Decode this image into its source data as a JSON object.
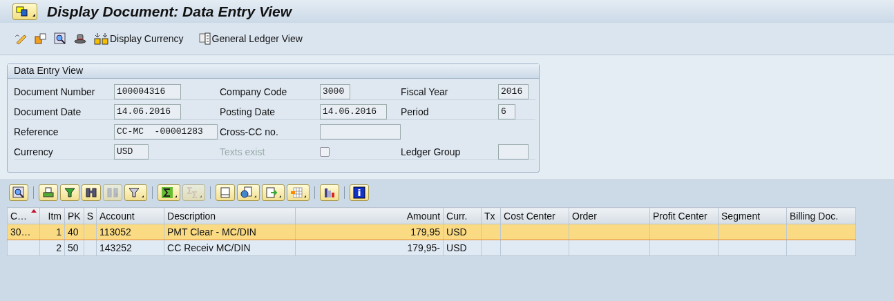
{
  "window": {
    "title": "Display Document: Data Entry View"
  },
  "app_toolbar": [
    {
      "kind": "pencil"
    },
    {
      "kind": "switch"
    },
    {
      "kind": "zoom"
    },
    {
      "kind": "hat"
    },
    {
      "kind": "currency",
      "label": "Display Currency"
    },
    {
      "kind": "ledger",
      "label": "General Ledger View"
    }
  ],
  "header": {
    "title": "Data Entry View",
    "rows": [
      [
        {
          "label": "Document Number",
          "value": "100004316",
          "kind": "field",
          "disabled": false
        },
        {
          "label": "Company Code",
          "value": "3000",
          "kind": "field",
          "disabled": false
        },
        {
          "label": "Fiscal Year",
          "value": "2016",
          "kind": "field",
          "disabled": false
        }
      ],
      [
        {
          "label": "Document Date",
          "value": "14.06.2016",
          "kind": "field",
          "disabled": false
        },
        {
          "label": "Posting Date",
          "value": "14.06.2016",
          "kind": "field",
          "disabled": false
        },
        {
          "label": "Period",
          "value": "6",
          "kind": "field",
          "disabled": false
        }
      ],
      [
        {
          "label": "Reference",
          "value": "CC-MC  -00001283",
          "kind": "field",
          "disabled": false
        },
        {
          "label": "Cross-CC no.",
          "kind": "field",
          "disabled": false
        }
      ],
      [
        {
          "label": "Currency",
          "value": "USD",
          "kind": "field",
          "disabled": false
        },
        {
          "label": "Texts exist",
          "kind": "checkbox",
          "checked": false,
          "disabled": true
        },
        {
          "label": "Ledger Group",
          "kind": "field",
          "disabled": false
        }
      ]
    ]
  },
  "grid_toolbar": [
    [
      {
        "kind": "zoom",
        "dropdown": false,
        "disabled": false
      }
    ],
    [
      {
        "kind": "print",
        "dropdown": false,
        "disabled": false
      },
      {
        "kind": "funnel",
        "dropdown": false,
        "disabled": false
      },
      {
        "kind": "find",
        "dropdown": false,
        "disabled": false
      },
      {
        "kind": "find-next",
        "dropdown": false,
        "disabled": true
      },
      {
        "kind": "filter",
        "dropdown": true,
        "disabled": false
      }
    ],
    [
      {
        "kind": "sum",
        "dropdown": true,
        "disabled": false
      },
      {
        "kind": "subtotal",
        "dropdown": true,
        "disabled": true
      }
    ],
    [
      {
        "kind": "document",
        "dropdown": false,
        "disabled": false
      },
      {
        "kind": "views",
        "dropdown": true,
        "disabled": false
      },
      {
        "kind": "export",
        "dropdown": true,
        "disabled": false
      },
      {
        "kind": "layout",
        "dropdown": true,
        "disabled": false
      }
    ],
    [
      {
        "kind": "chart",
        "dropdown": false,
        "disabled": false
      }
    ],
    [
      {
        "kind": "info",
        "dropdown": false,
        "disabled": false
      }
    ]
  ],
  "table": {
    "columns": [
      {
        "label": "C…",
        "sorted": true
      },
      {
        "label": "Itm",
        "sorted": false
      },
      {
        "label": "PK",
        "sorted": false
      },
      {
        "label": "S",
        "sorted": false
      },
      {
        "label": "Account",
        "sorted": false
      },
      {
        "label": "Description",
        "sorted": false
      },
      {
        "label": "Amount",
        "sorted": false
      },
      {
        "label": "Curr.",
        "sorted": false
      },
      {
        "label": "Tx",
        "sorted": false
      },
      {
        "label": "Cost Center",
        "sorted": false
      },
      {
        "label": "Order",
        "sorted": false
      },
      {
        "label": "Profit Center",
        "sorted": false
      },
      {
        "label": "Segment",
        "sorted": false
      },
      {
        "label": "Billing Doc.",
        "sorted": false
      }
    ],
    "rows": [
      {
        "selected": true,
        "cells": [
          "30…",
          "1",
          "40",
          "",
          "113052",
          "PMT Clear - MC/DIN",
          "179,95",
          "USD",
          "",
          "",
          "",
          "",
          "",
          ""
        ]
      },
      {
        "selected": false,
        "cells": [
          "",
          "2",
          "50",
          "",
          "143252",
          "CC Receiv MC/DIN",
          "179,95-",
          "USD",
          "",
          "",
          "",
          "",
          "",
          ""
        ]
      }
    ]
  }
}
